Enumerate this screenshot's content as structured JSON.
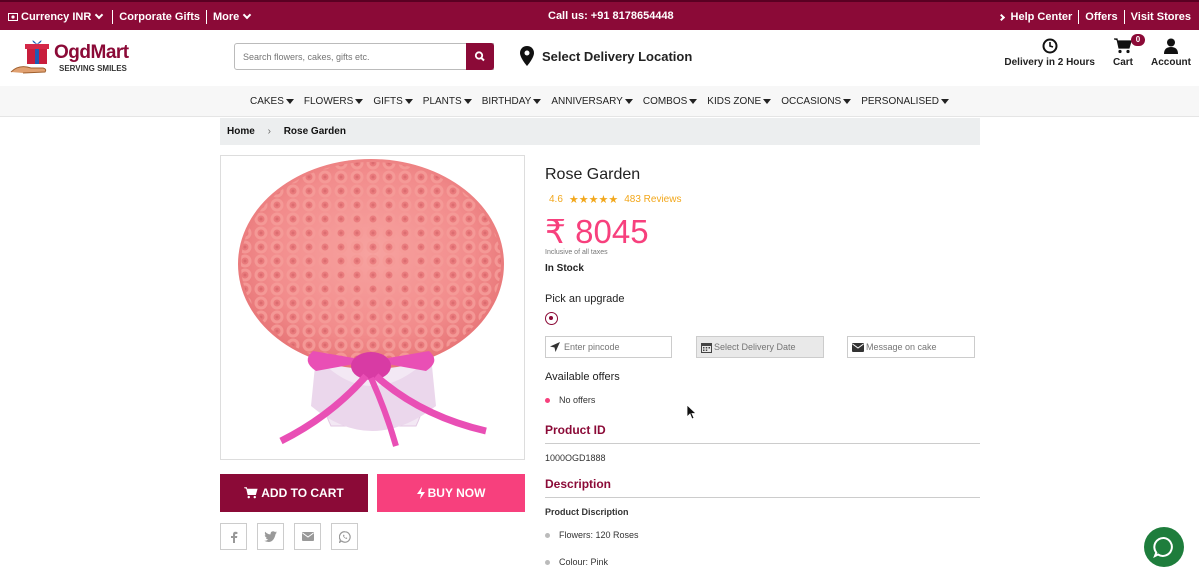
{
  "topbar": {
    "currency": "Currency INR",
    "corporate": "Corporate Gifts",
    "more": "More",
    "call": "Call us: +91 8178654448",
    "help": "Help Center",
    "offers": "Offers",
    "stores": "Visit Stores"
  },
  "header": {
    "logo_name": "OgdMart",
    "logo_tagline": "SERVING SMILES",
    "search_placeholder": "Search flowers, cakes, gifts etc.",
    "location": "Select Delivery Location",
    "delivery": "Delivery in 2 Hours",
    "cart": "Cart",
    "cart_count": "0",
    "account": "Account"
  },
  "nav": [
    "CAKES",
    "FLOWERS",
    "GIFTS",
    "PLANTS",
    "BIRTHDAY",
    "ANNIVERSARY",
    "COMBOS",
    "KIDS ZONE",
    "OCCASIONS",
    "PERSONALISED"
  ],
  "breadcrumb": {
    "home": "Home",
    "current": "Rose Garden"
  },
  "product": {
    "title": "Rose Garden",
    "rating": "4.6",
    "stars": "★★★★★",
    "reviews": "483 Reviews",
    "price": "₹ 8045",
    "tax_note": "Inclusive of all taxes",
    "stock": "In Stock",
    "upgrade_label": "Pick an upgrade",
    "pincode_placeholder": "Enter pincode",
    "date_placeholder": "Select Delivery Date",
    "message_placeholder": "Message on cake",
    "offers_label": "Available offers",
    "offer_item": "No offers",
    "id_heading": "Product ID",
    "id_value": "1000OGD1888",
    "desc_heading": "Description",
    "desc_sub": "Product Discription",
    "desc_items": [
      "Flowers: 120 Roses",
      "Colour: Pink"
    ]
  },
  "actions": {
    "add_to_cart": "ADD TO CART",
    "buy_now": "BUY NOW"
  },
  "colors": {
    "brand": "#8b0a37",
    "accent": "#f7407d",
    "star": "#f2a71b",
    "chat": "#1e7d3c"
  },
  "icons": [
    "currency-icon",
    "search-icon",
    "map-pin-icon",
    "clock-icon",
    "cart-icon",
    "user-icon",
    "location-arrow-icon",
    "calendar-icon",
    "envelope-icon",
    "facebook-icon",
    "twitter-icon",
    "mail-icon",
    "whatsapp-icon",
    "chat-icon"
  ]
}
